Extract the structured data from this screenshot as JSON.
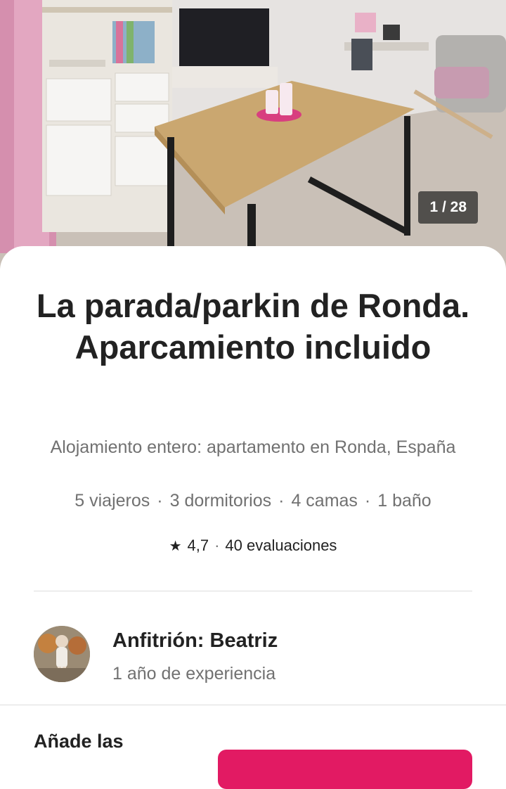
{
  "photo": {
    "counter": "1 / 28"
  },
  "listing": {
    "title": "La parada/parkin de Ronda. Aparcamiento incluido",
    "subtitle": "Alojamiento entero: apartamento en Ronda, España",
    "stats": [
      "5 viajeros",
      "3 dormitorios",
      "4 camas",
      "1 baño"
    ],
    "stats_separator": "·",
    "rating": {
      "star_icon": "star-icon",
      "score": "4,7",
      "separator": "·",
      "reviews": "40 evaluaciones"
    }
  },
  "host": {
    "name_label": "Anfitrión: Beatriz",
    "experience": "1 año de experiencia"
  },
  "booking": {
    "dates_label": "Añade las"
  },
  "colors": {
    "accent": "#e21a63",
    "text_primary": "#222222",
    "text_secondary": "#717171"
  }
}
